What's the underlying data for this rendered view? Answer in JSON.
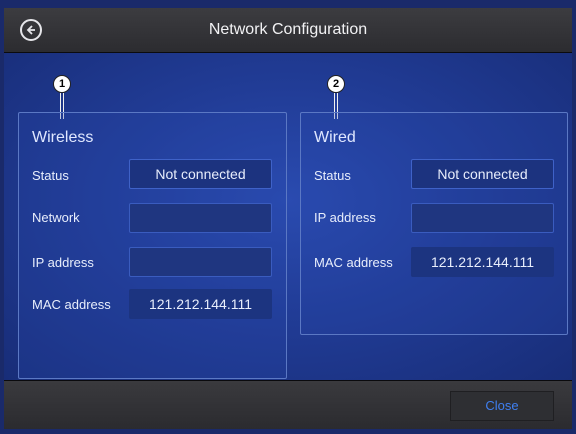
{
  "header": {
    "title": "Network Configuration"
  },
  "callouts": [
    "1",
    "2"
  ],
  "wireless": {
    "title": "Wireless",
    "status_label": "Status",
    "status_value": "Not connected",
    "network_label": "Network",
    "network_value": "",
    "ip_label": "IP address",
    "ip_value": "",
    "mac_label": "MAC address",
    "mac_value": "121.212.144.111"
  },
  "wired": {
    "title": "Wired",
    "status_label": "Status",
    "status_value": "Not connected",
    "ip_label": "IP address",
    "ip_value": "",
    "mac_label": "MAC address",
    "mac_value": "121.212.144.111"
  },
  "footer": {
    "close_label": "Close"
  },
  "colors": {
    "background": "#213c96",
    "accent": "#3f7ff0",
    "titlebar": "#333337"
  },
  "icons": {
    "back": "back-arrow-circle-icon"
  }
}
